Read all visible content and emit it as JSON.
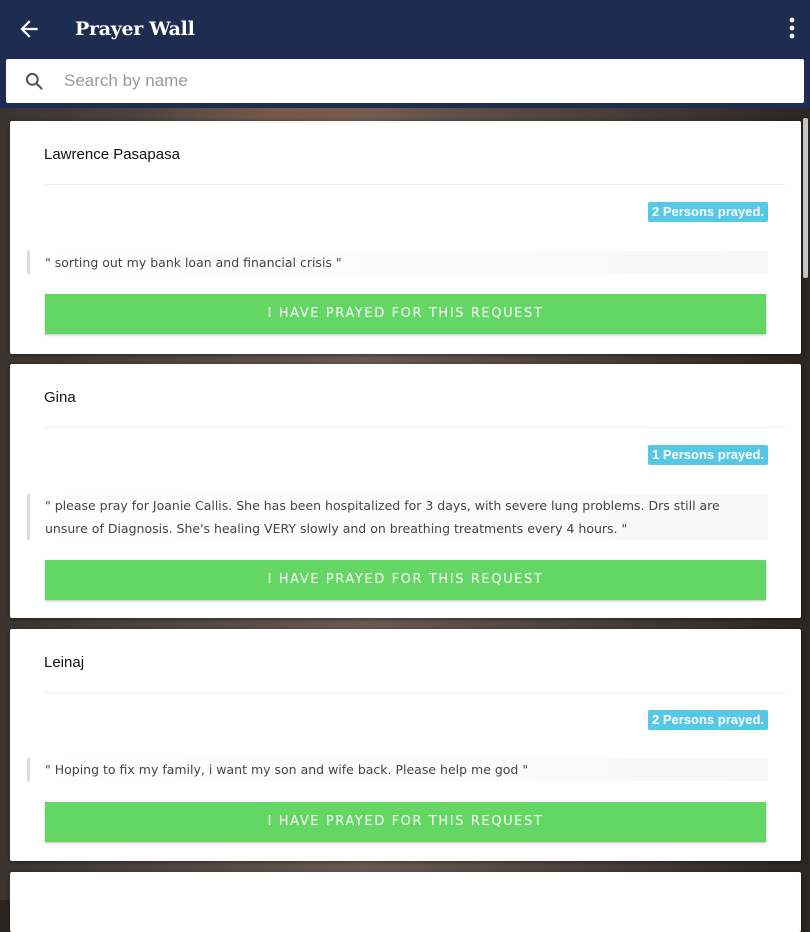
{
  "appbar": {
    "title": "Prayer Wall"
  },
  "search": {
    "placeholder": "Search by name"
  },
  "requests": [
    {
      "name": "Lawrence Pasapasa",
      "count_label": "2 Persons prayed.",
      "text": "\" sorting out my bank loan and financial crisis \"",
      "button": "I HAVE PRAYED FOR THIS REQUEST"
    },
    {
      "name": "Gina",
      "count_label": "1 Persons prayed.",
      "text": "\" please pray for Joanie Callis. She has been hospitalized for 3 days, with severe lung problems. Drs still are unsure of Diagnosis. She's healing VERY slowly and on breathing treatments every 4 hours. \"",
      "button": "I HAVE PRAYED FOR THIS REQUEST"
    },
    {
      "name": "Leinaj",
      "count_label": "2 Persons prayed.",
      "text": "\" Hoping to fix my family, i want my son and wife back. Please help me god \"",
      "button": "I HAVE PRAYED FOR THIS REQUEST"
    }
  ],
  "colors": {
    "appbar": "#1f2c52",
    "badge": "#55c8e6",
    "button": "#63d663"
  },
  "icons": {
    "back": "arrow-left-icon",
    "menu": "more-vert-icon",
    "search": "search-icon"
  }
}
